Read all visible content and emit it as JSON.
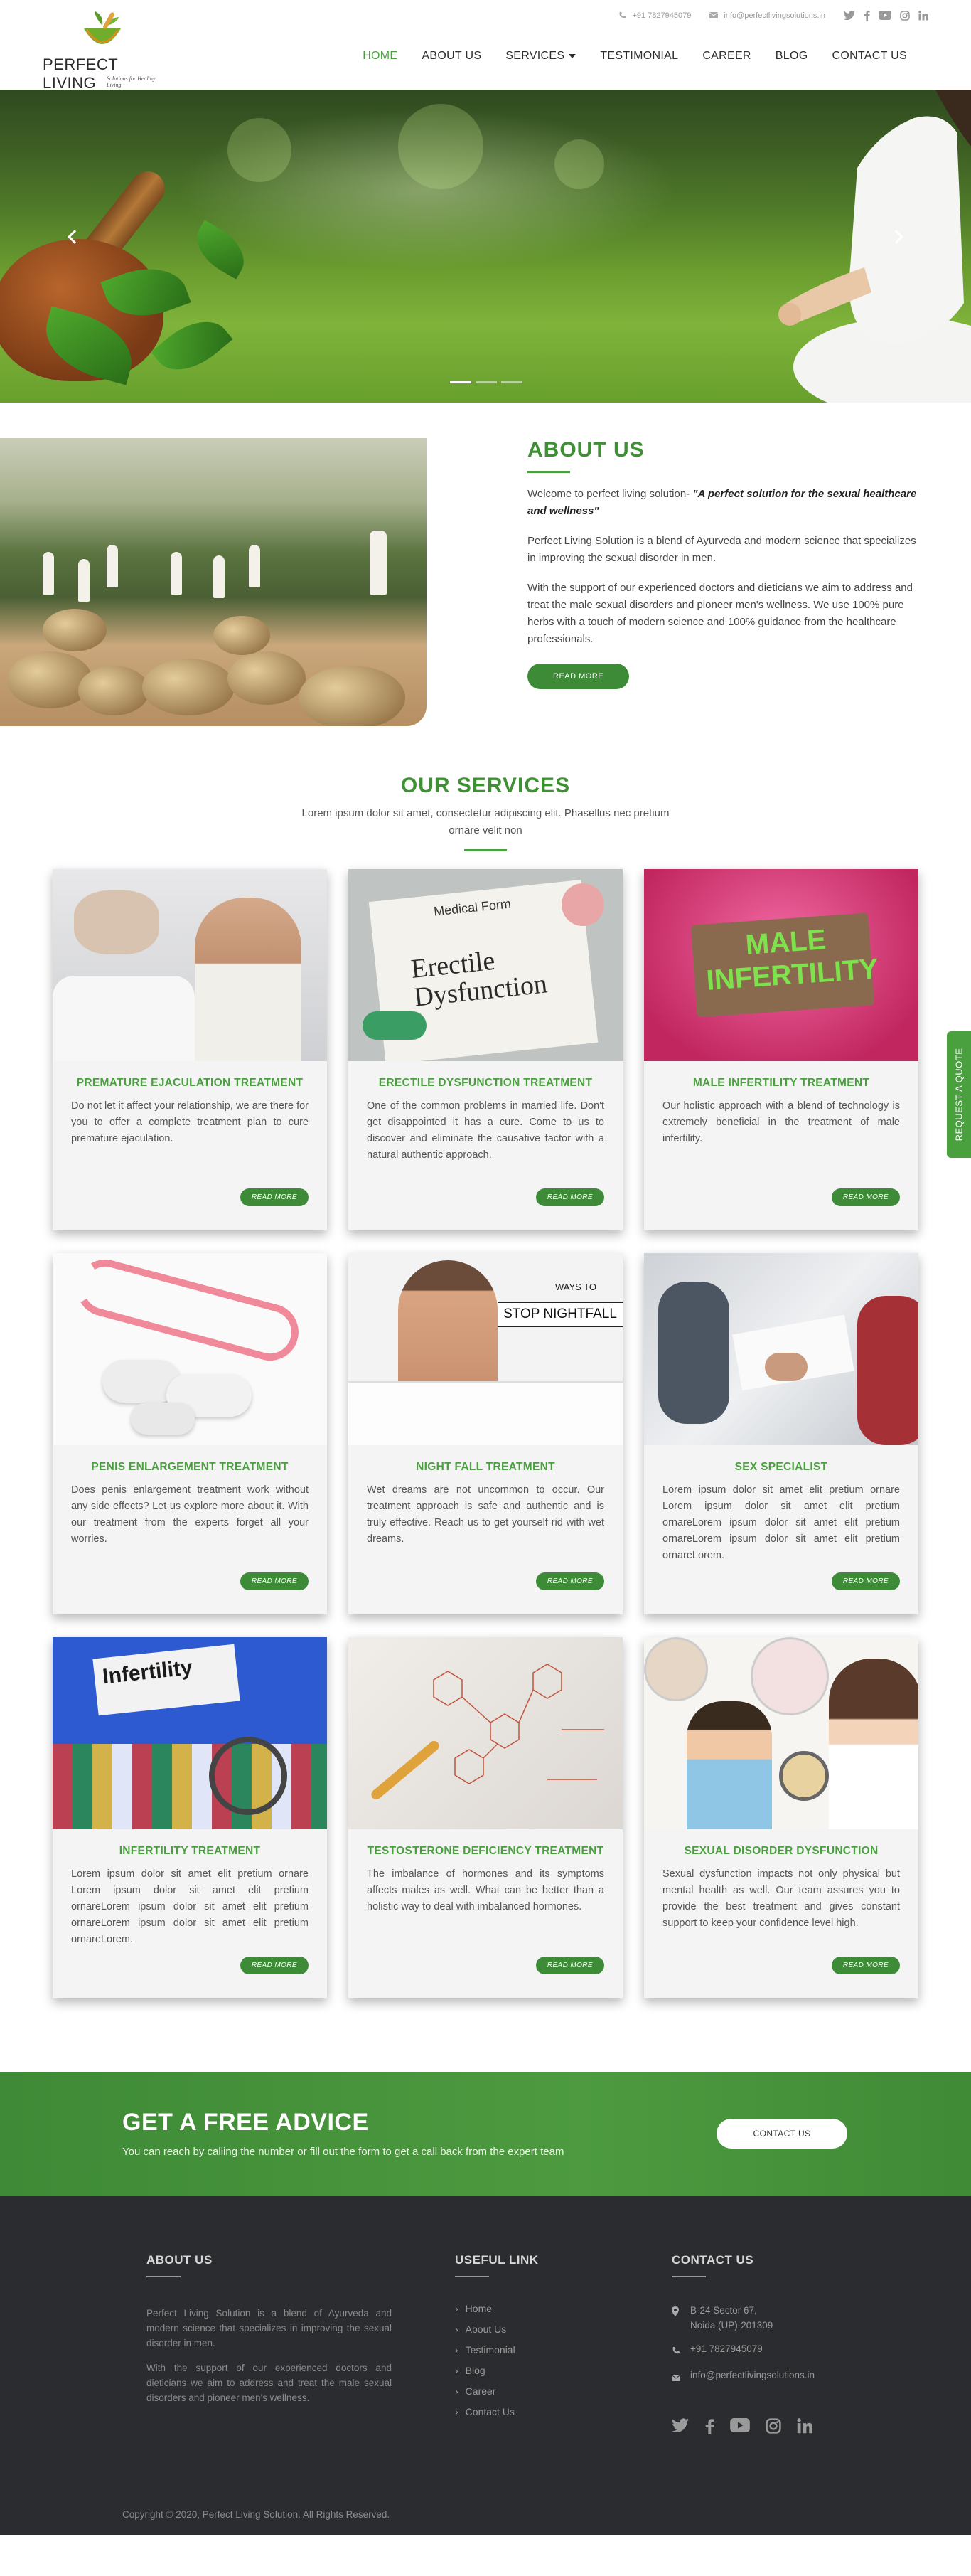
{
  "brand": {
    "name": "PERFECT LIVING",
    "tagline": "Solutions for Healthy Living"
  },
  "topbar": {
    "phone": "+91 7827945079",
    "email": "info@perfectlivingsolutions.in",
    "social_icons": [
      "twitter-icon",
      "facebook-icon",
      "youtube-icon",
      "instagram-icon",
      "linkedin-icon"
    ]
  },
  "nav": {
    "items": [
      {
        "label": "HOME",
        "active": true
      },
      {
        "label": "ABOUT US"
      },
      {
        "label": "SERVICES",
        "dropdown": true
      },
      {
        "label": "TESTIMONIAL"
      },
      {
        "label": "CAREER"
      },
      {
        "label": "BLOG"
      },
      {
        "label": "CONTACT US"
      }
    ]
  },
  "about": {
    "title": "ABOUT US",
    "welcome_prefix": "Welcome to perfect living solution- ",
    "welcome_em": "\"A perfect solution for the sexual healthcare and wellness\"",
    "para1": "Perfect Living Solution is a blend of Ayurveda and modern science that specializes in improving the sexual disorder in men.",
    "para2": "With the support of our experienced doctors and dieticians we aim to address and treat the male sexual disorders and pioneer men's wellness. We use 100% pure herbs with a touch of modern science and 100% guidance from the healthcare professionals.",
    "button": "READ MORE"
  },
  "services": {
    "title": "OUR SERVICES",
    "subtitle": "Lorem ipsum dolor sit amet, consectetur adipiscing elit. Phasellus nec pretium ornare velit non",
    "cards": [
      {
        "title": "PREMATURE EJACULATION TREATMENT",
        "text": "Do not let it affect your relationship, we are there for you to offer a complete treatment plan to cure premature ejaculation.",
        "button": "READ MORE"
      },
      {
        "title": "ERECTILE DYSFUNCTION TREATMENT",
        "text": "One of the common problems in married life. Don't get disappointed it has a cure. Come to us to discover and eliminate the causative factor with a natural authentic approach.",
        "button": "READ MORE",
        "img_heading": "Medical Form",
        "img_text": "Erectile Dysfunction"
      },
      {
        "title": "MALE INFERTILITY TREATMENT",
        "text": "Our holistic approach with a blend of technology is extremely beneficial in the treatment of male infertility.",
        "button": "READ MORE",
        "img_text": "MALE INFERTILITY"
      },
      {
        "title": "PENIS ENLARGEMENT TREATMENT",
        "text": "Does penis enlargement treatment work without any side effects? Let us explore more about it. With our treatment from the experts forget all your worries.",
        "button": "READ MORE"
      },
      {
        "title": "NIGHT FALL TREATMENT",
        "text": "Wet dreams are not uncommon to occur. Our treatment approach is safe and authentic and is truly effective. Reach us to get yourself rid with wet dreams.",
        "button": "READ MORE",
        "img_text1": "WAYS TO",
        "img_text2": "STOP NIGHTFALL"
      },
      {
        "title": "SEX SPECIALIST",
        "text": "Lorem ipsum dolor sit amet elit pretium ornare Lorem ipsum dolor sit amet elit pretium ornareLorem ipsum dolor sit amet elit pretium ornareLorem ipsum dolor sit amet elit pretium ornareLorem.",
        "button": "READ MORE"
      },
      {
        "title": "INFERTILITY TREATMENT",
        "text": "Lorem ipsum dolor sit amet elit pretium ornare Lorem ipsum dolor sit amet elit pretium ornareLorem ipsum dolor sit amet elit pretium ornareLorem ipsum dolor sit amet elit pretium ornareLorem.",
        "button": "READ MORE",
        "img_text": "Infertility"
      },
      {
        "title": "TESTOSTERONE DEFICIENCY TREATMENT",
        "text": "The imbalance of hormones and its symptoms affects males as well. What can be better than a holistic way to deal with imbalanced hormones.",
        "button": "READ MORE"
      },
      {
        "title": "SEXUAL DISORDER DYSFUNCTION",
        "text": "Sexual dysfunction impacts not only physical but mental health as well. Our team assures you to provide the best treatment and gives constant support to keep your confidence level high.",
        "button": "READ MORE"
      }
    ]
  },
  "quote_tab": "REQUEST A QUOTE",
  "advice": {
    "title": "GET A FREE ADVICE",
    "subtitle": "You can reach by calling the number or fill out the form to get a call back from the expert team",
    "button": "CONTACT US"
  },
  "footer": {
    "about_title": "ABOUT US",
    "about_p1": "Perfect Living Solution is a blend of Ayurveda and modern science that specializes in improving the sexual disorder in men.",
    "about_p2": "With the support of our experienced doctors and dieticians we aim to address and treat the male sexual disorders and pioneer men's wellness.",
    "links_title": "USEFUL LINK",
    "links": [
      "Home",
      "About Us",
      "Testimonial",
      "Blog",
      "Career",
      "Contact Us"
    ],
    "contact_title": "CONTACT US",
    "address1": "B-24 Sector 67,",
    "address2": "Noida (UP)-201309",
    "phone": "+91 7827945079",
    "email": "info@perfectlivingsolutions.in",
    "copyright": "Copyright © 2020, Perfect Living Solution. All Rights Reserved."
  },
  "colors": {
    "brand_green": "#4a9f3f",
    "dark_green": "#3d8b36",
    "footer_bg": "#2b2c2f"
  }
}
